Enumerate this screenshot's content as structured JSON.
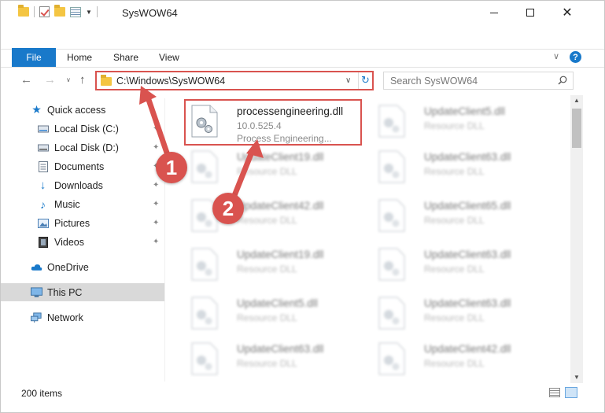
{
  "window": {
    "title": "SysWOW64",
    "minimize_symbol": "",
    "close_symbol": "✕"
  },
  "ribbon": {
    "file_tab": "File",
    "tabs": [
      "Home",
      "Share",
      "View"
    ],
    "help_symbol": "?",
    "collapse_symbol": "∨"
  },
  "navigation": {
    "back_symbol": "←",
    "forward_symbol": "→",
    "recent_symbol": "∨",
    "up_symbol": "↑",
    "address": "C:\\Windows\\SysWOW64",
    "address_dropdown": "∨",
    "refresh_symbol": "↻",
    "search_placeholder": "Search SysWOW64"
  },
  "sidebar": {
    "items": [
      {
        "label": "Quick access",
        "icon": "star-icon",
        "pinned": false
      },
      {
        "label": "Local Disk (C:)",
        "icon": "drive-icon",
        "pinned": true
      },
      {
        "label": "Local Disk (D:)",
        "icon": "drive-icon",
        "pinned": true
      },
      {
        "label": "Documents",
        "icon": "documents-icon",
        "pinned": true
      },
      {
        "label": "Downloads",
        "icon": "download-icon",
        "pinned": true
      },
      {
        "label": "Music",
        "icon": "music-icon",
        "pinned": true
      },
      {
        "label": "Pictures",
        "icon": "pictures-icon",
        "pinned": true
      },
      {
        "label": "Videos",
        "icon": "videos-icon",
        "pinned": true
      },
      {
        "label": "OneDrive",
        "icon": "cloud-icon",
        "pinned": false
      },
      {
        "label": "This PC",
        "icon": "computer-icon",
        "pinned": false,
        "selected": true
      },
      {
        "label": "Network",
        "icon": "network-icon",
        "pinned": false
      }
    ],
    "pin_symbol": "📌"
  },
  "files": {
    "highlighted": {
      "name": "processengineering.dll",
      "version": "10.0.525.4",
      "description": "Process Engineering..."
    },
    "left_column": [
      {
        "name": "UpdateClient19.dll",
        "description": "Resource DLL"
      },
      {
        "name": "UpdateClient42.dll",
        "description": "Resource DLL"
      },
      {
        "name": "UpdateClient19.dll",
        "description": "Resource DLL"
      },
      {
        "name": "UpdateClient5.dll",
        "description": "Resource DLL"
      },
      {
        "name": "UpdateClient63.dll",
        "description": "Resource DLL"
      }
    ],
    "right_column": [
      {
        "name": "UpdateClient5.dll",
        "description": "Resource DLL"
      },
      {
        "name": "UpdateClient63.dll",
        "description": "Resource DLL"
      },
      {
        "name": "UpdateClient65.dll",
        "description": "Resource DLL"
      },
      {
        "name": "UpdateClient63.dll",
        "description": "Resource DLL"
      },
      {
        "name": "UpdateClient63.dll",
        "description": "Resource DLL"
      },
      {
        "name": "UpdateClient42.dll",
        "description": "Resource DLL"
      }
    ]
  },
  "status": {
    "item_count": "200 items"
  },
  "annotations": {
    "step1": "1",
    "step2": "2",
    "color": "#d9534f"
  },
  "colors": {
    "accent": "#1979ca",
    "highlight": "#d9534f"
  }
}
